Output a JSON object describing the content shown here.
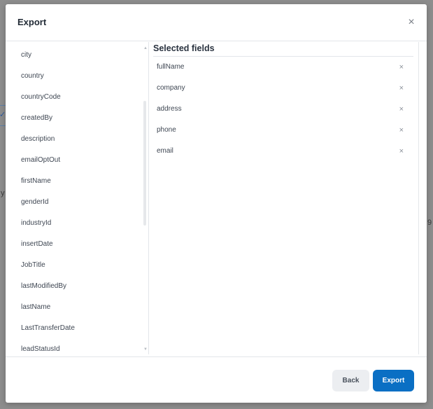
{
  "background": {
    "frag_y": "y",
    "frag_9": "9",
    "check_glyph": "✓"
  },
  "modal": {
    "title": "Export",
    "close_glyph": "×"
  },
  "available_fields": [
    "city",
    "country",
    "countryCode",
    "createdBy",
    "description",
    "emailOptOut",
    "firstName",
    "genderId",
    "industryId",
    "insertDate",
    "JobTitle",
    "lastModifiedBy",
    "lastName",
    "LastTransferDate",
    "leadStatusId"
  ],
  "selected": {
    "title": "Selected fields",
    "remove_glyph": "×",
    "fields": [
      "fullName",
      "company",
      "address",
      "phone",
      "email"
    ]
  },
  "scroll": {
    "up_glyph": "▲",
    "down_glyph": "▼"
  },
  "footer": {
    "back_label": "Back",
    "export_label": "Export"
  }
}
